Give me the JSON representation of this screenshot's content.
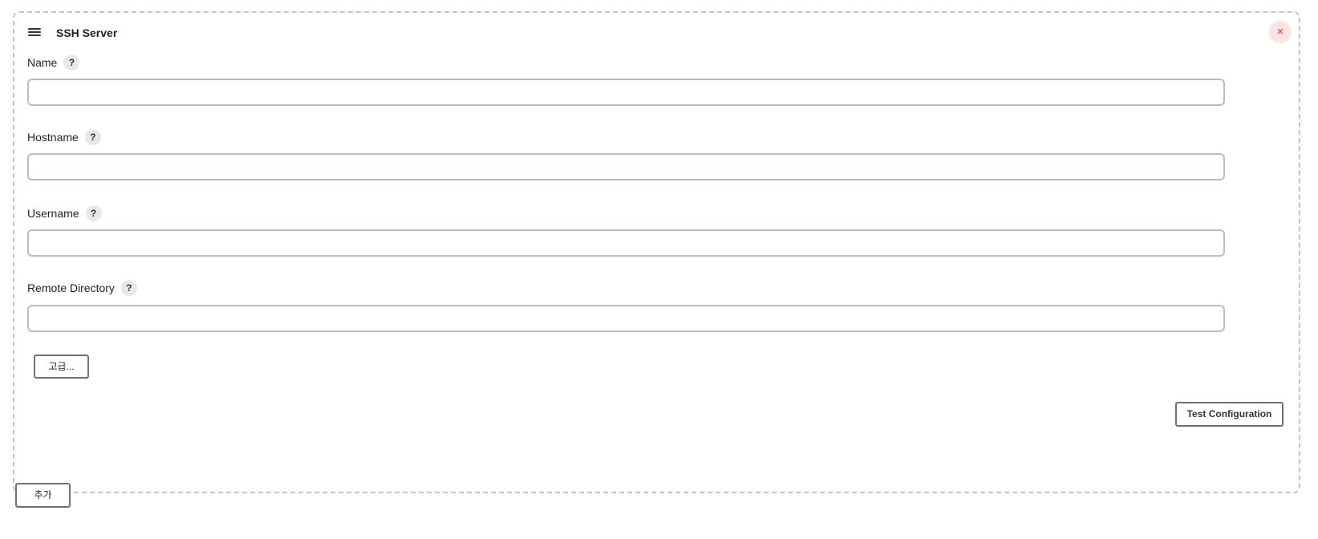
{
  "panel": {
    "title": "SSH Server",
    "close_glyph": "×",
    "fields": [
      {
        "label": "Name",
        "value": "",
        "help": "?"
      },
      {
        "label": "Hostname",
        "value": "",
        "help": "?"
      },
      {
        "label": "Username",
        "value": "",
        "help": "?"
      },
      {
        "label": "Remote Directory",
        "value": "",
        "help": "?"
      }
    ],
    "advanced_label": "고급...",
    "test_label": "Test Configuration"
  },
  "add_label": "추가",
  "icons": {
    "drag": "drag-handle-icon",
    "close": "close-icon",
    "help": "help-icon"
  },
  "colors": {
    "close_bg": "#fbe3e3",
    "close_fg": "#e0342e",
    "input_border": "#b5bec6",
    "panel_border": "#c3c4c7"
  }
}
